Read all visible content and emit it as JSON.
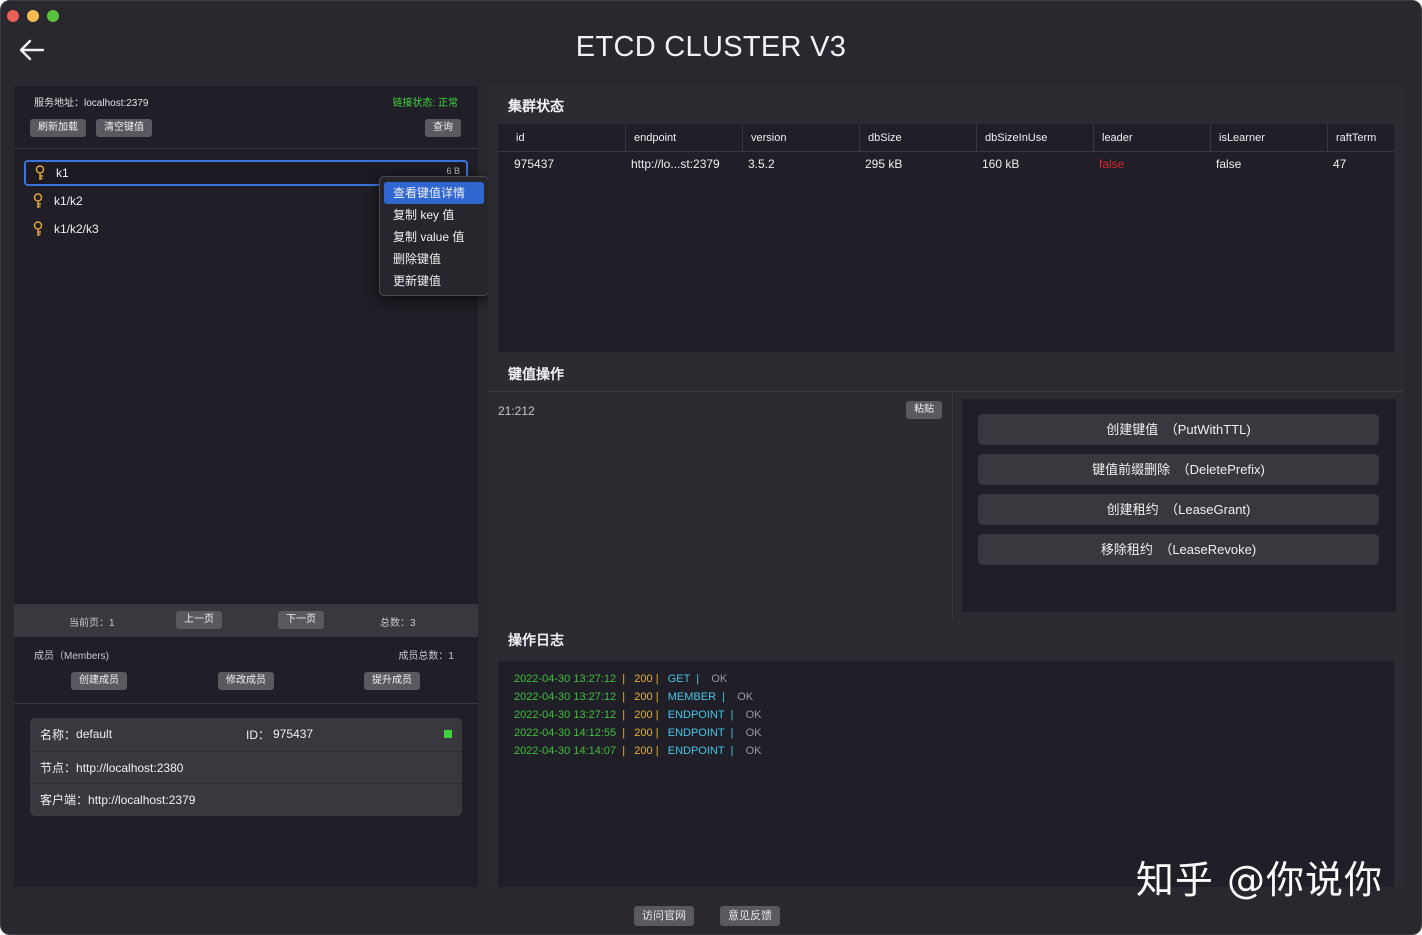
{
  "window": {
    "title": "ETCD CLUSTER V3"
  },
  "left": {
    "server_address": "服务地址：localhost:2379",
    "connection_status": "链接状态: 正常",
    "buttons": {
      "refresh": "刷新加载",
      "clear": "清空键值",
      "query": "查询"
    },
    "keys": [
      {
        "label": "k1",
        "size": "6 B"
      },
      {
        "label": "k1/k2"
      },
      {
        "label": "k1/k2/k3"
      }
    ],
    "context_menu": [
      "查看键值详情",
      "复制 key 值",
      "复制 value 值",
      "删除键值",
      "更新键值"
    ],
    "pager": {
      "current": "当前页：1",
      "prev": "上一页",
      "next": "下一页",
      "total": "总数：3"
    },
    "members": {
      "label": "成员（Members)",
      "total": "成员总数：1",
      "buttons": {
        "create": "创建成员",
        "edit": "修改成员",
        "promote": "提升成员"
      },
      "card": {
        "name_label": "名称：",
        "name": "default",
        "id_label": "ID：",
        "id": "975437",
        "node_label": "节点：",
        "node": "http://localhost:2380",
        "client_label": "客户端：",
        "client": "http://localhost:2379",
        "status_color": "#3fd43f"
      }
    }
  },
  "cluster": {
    "title": "集群状态",
    "columns": [
      "id",
      "endpoint",
      "version",
      "dbSize",
      "dbSizeInUse",
      "leader",
      "isLearner",
      "raftTerm"
    ],
    "rows": [
      [
        "975437",
        "http://lo...st:2379",
        "3.5.2",
        "295 kB",
        "160 kB",
        "false",
        "false",
        "47"
      ]
    ]
  },
  "kv": {
    "title": "键值操作",
    "value": "21:212",
    "paste": "粘贴",
    "ops": [
      "创建键值　（PutWithTTL)",
      "键值前缀删除　（DeletePrefix)",
      "创建租约　（LeaseGrant)",
      "移除租约　（LeaseRevoke)"
    ]
  },
  "log": {
    "title": "操作日志",
    "lines": [
      {
        "time": "2022-04-30 13:27:12",
        "code": "200",
        "op": "GET",
        "result": "OK"
      },
      {
        "time": "2022-04-30 13:27:12",
        "code": "200",
        "op": "MEMBER",
        "result": "OK"
      },
      {
        "time": "2022-04-30 13:27:12",
        "code": "200",
        "op": "ENDPOINT",
        "result": "OK"
      },
      {
        "time": "2022-04-30 14:12:55",
        "code": "200",
        "op": "ENDPOINT",
        "result": "OK"
      },
      {
        "time": "2022-04-30 14:14:07",
        "code": "200",
        "op": "ENDPOINT",
        "result": "OK"
      }
    ]
  },
  "footer": {
    "website": "访问官网",
    "feedback": "意见反馈"
  },
  "watermark": "知乎 @你说你",
  "colors": {
    "accent": "#2f66d0",
    "ok_green": "#3fd43f",
    "leader_false": "#d42a2a"
  },
  "icons": {
    "back": "arrow-left-icon",
    "key": "key-icon"
  }
}
